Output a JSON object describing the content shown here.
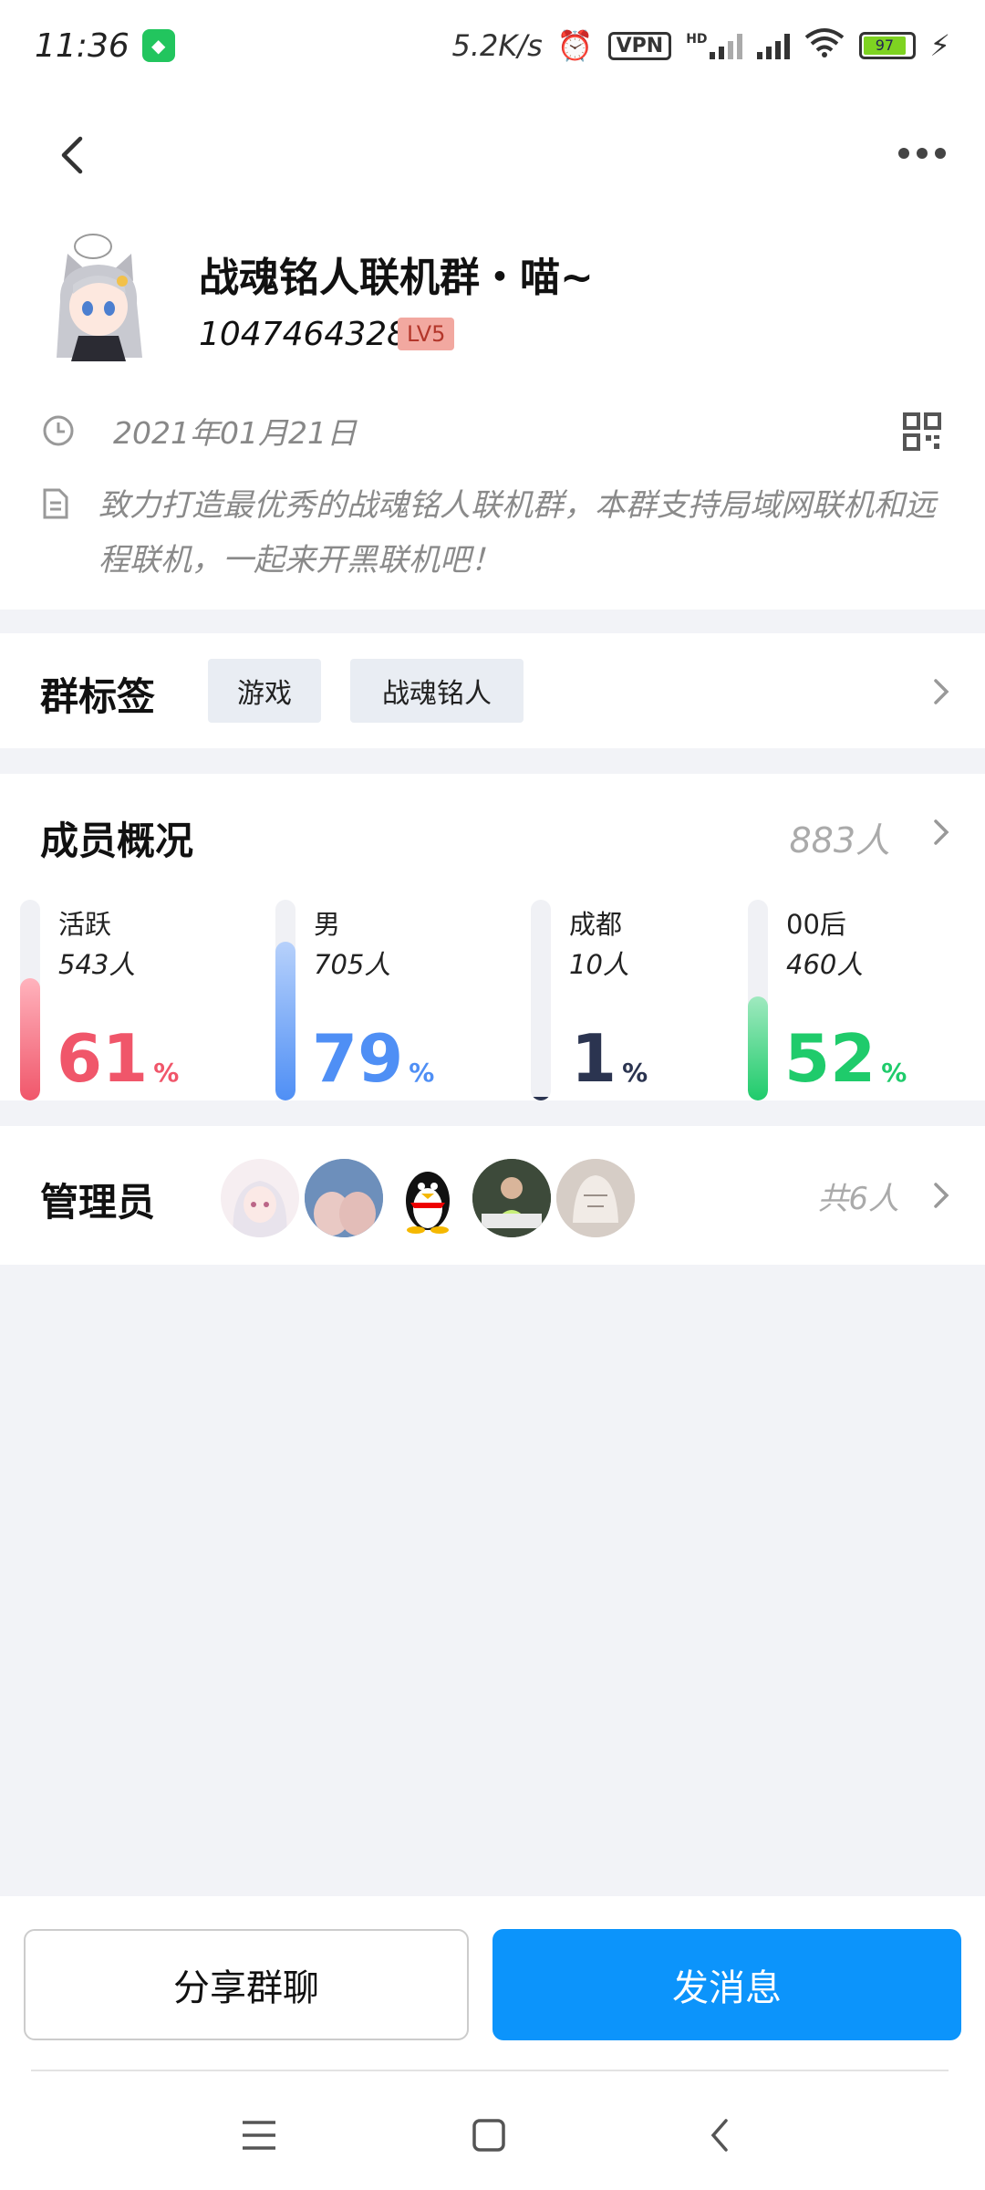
{
  "status_bar": {
    "time": "11:36",
    "net_speed": "5.2K/s",
    "vpn": "VPN",
    "hd": "HD",
    "battery": "97"
  },
  "header": {
    "back_icon": "chevron-left-icon",
    "more_icon": "more-dots-icon"
  },
  "group": {
    "name": "战魂铭人联机群・喵~",
    "id": "1047464328",
    "level": "LV5",
    "created_date": "2021年01月21日",
    "description": "致力打造最优秀的战魂铭人联机群，本群支持局域网联机和远程联机，一起来开黑联机吧！"
  },
  "tags_section": {
    "title": "群标签",
    "tags": [
      "游戏",
      "战魂铭人"
    ]
  },
  "members_section": {
    "title": "成员概况",
    "total": "883人",
    "stats": [
      {
        "label": "活跃",
        "count": "543人",
        "percent": "61",
        "unit": "%",
        "fraction": 0.61,
        "color": "#f0566a",
        "light": "#ffb3bd"
      },
      {
        "label": "男",
        "count": "705人",
        "percent": "79",
        "unit": "%",
        "fraction": 0.79,
        "color": "#4f8ff5",
        "light": "#b7d1fb"
      },
      {
        "label": "成都",
        "count": "10人",
        "percent": "1",
        "unit": "%",
        "fraction": 0.01,
        "color": "#2b3450",
        "light": "#2b3450"
      },
      {
        "label": "00后",
        "count": "460人",
        "percent": "52",
        "unit": "%",
        "fraction": 0.52,
        "color": "#1fcb6b",
        "light": "#9fe9bf"
      }
    ]
  },
  "admins_section": {
    "title": "管理员",
    "total": "共6人"
  },
  "actions": {
    "share": "分享群聊",
    "send": "发消息"
  },
  "colors": {
    "accent": "#0c94fb",
    "background": "#f2f3f7"
  }
}
